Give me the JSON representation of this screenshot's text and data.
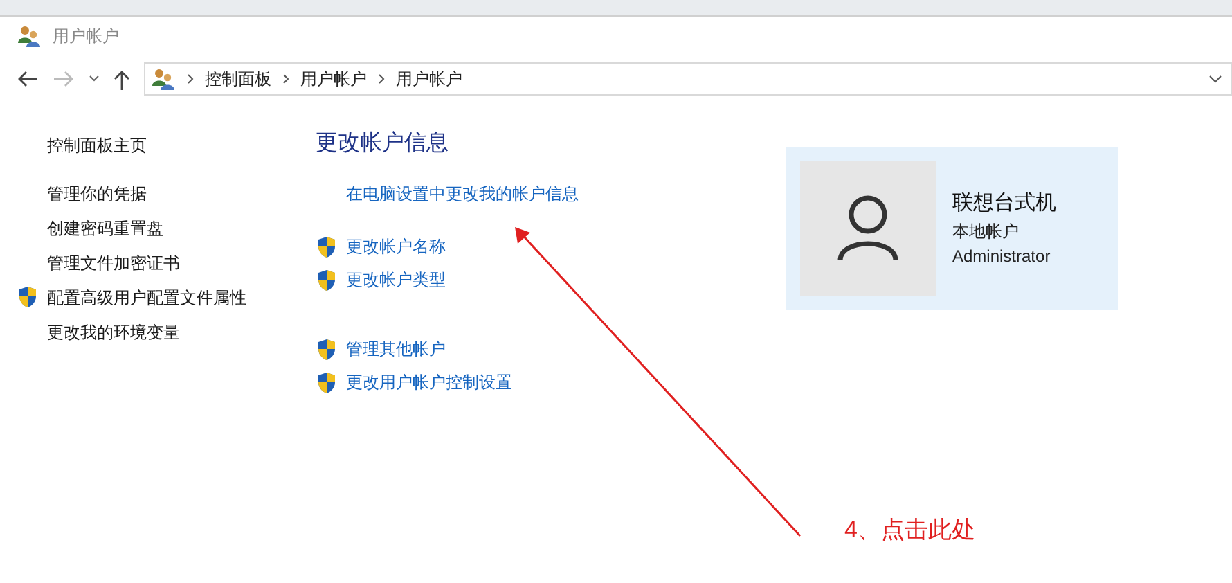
{
  "window": {
    "title": "用户帐户"
  },
  "breadcrumb": [
    "控制面板",
    "用户帐户",
    "用户帐户"
  ],
  "sidebar": {
    "items": [
      {
        "label": "控制面板主页",
        "shield": false
      },
      {
        "label": "管理你的凭据",
        "shield": false
      },
      {
        "label": "创建密码重置盘",
        "shield": false
      },
      {
        "label": "管理文件加密证书",
        "shield": false
      },
      {
        "label": "配置高级用户配置文件属性",
        "shield": true
      },
      {
        "label": "更改我的环境变量",
        "shield": false
      }
    ]
  },
  "main": {
    "heading": "更改帐户信息",
    "links": [
      {
        "label": "在电脑设置中更改我的帐户信息",
        "shield": false
      },
      {
        "label": "更改帐户名称",
        "shield": true
      },
      {
        "label": "更改帐户类型",
        "shield": true
      },
      {
        "label": "管理其他帐户",
        "shield": true
      },
      {
        "label": "更改用户帐户控制设置",
        "shield": true
      }
    ]
  },
  "account": {
    "name": "联想台式机",
    "type": "本地帐户",
    "role": "Administrator"
  },
  "annotation": {
    "text": "4、点击此处"
  }
}
